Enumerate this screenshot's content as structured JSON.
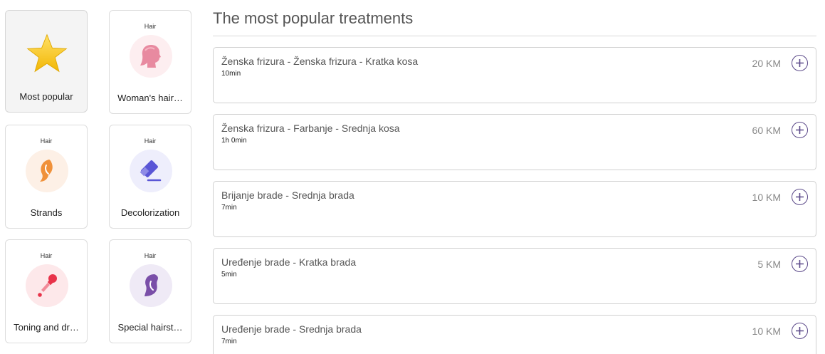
{
  "categories": [
    {
      "tag": "",
      "label": "Most popular",
      "icon": "star-icon",
      "active": true
    },
    {
      "tag": "Hair",
      "label": "Woman's hair…",
      "icon": "woman-head-icon"
    },
    {
      "tag": "Hair",
      "label": "Strands",
      "icon": "hair-strand-icon"
    },
    {
      "tag": "Hair",
      "label": "Decolorization",
      "icon": "eraser-icon"
    },
    {
      "tag": "Hair",
      "label": "Toning and dr…",
      "icon": "dropper-icon"
    },
    {
      "tag": "Hair",
      "label": "Special hairst…",
      "icon": "hairstyle-icon"
    }
  ],
  "section": {
    "title": "The most popular treatments"
  },
  "treatments": [
    {
      "name": "Ženska frizura - Ženska frizura - Kratka kosa",
      "duration": "10min",
      "price": "20 KM"
    },
    {
      "name": "Ženska frizura - Farbanje - Srednja kosa",
      "duration": "1h 0min",
      "price": "60 KM"
    },
    {
      "name": "Brijanje brade - Srednja brada",
      "duration": "7min",
      "price": "10 KM"
    },
    {
      "name": "Uređenje brade - Kratka brada",
      "duration": "5min",
      "price": "5 KM"
    },
    {
      "name": "Uređenje brade - Srednja brada",
      "duration": "7min",
      "price": "10 KM"
    }
  ],
  "colors": {
    "accent": "#5c4a8a",
    "star": "#f5c518",
    "pink": "#e88aa0",
    "orange": "#f0913a",
    "eraser": "#5a56d6",
    "red": "#e8334a",
    "purple": "#7a4fa8"
  }
}
